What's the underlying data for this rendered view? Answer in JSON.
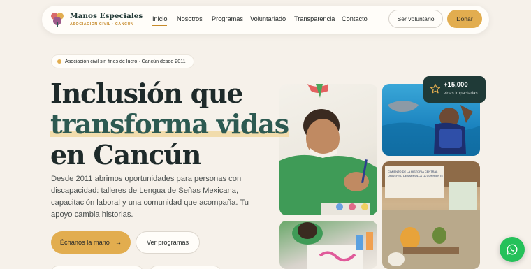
{
  "nav": {
    "brand_name": "Manos Especiales",
    "brand_sub": "ASOCIACIÓN CIVIL · CANCÚN",
    "links": [
      "Inicio",
      "Nosotros",
      "Programas",
      "Voluntariado",
      "Transparencia",
      "Contacto"
    ],
    "active_link": "Inicio",
    "volunteer_label": "Ser voluntario",
    "donate_label": "Donar"
  },
  "hero": {
    "badge": "Asociación civil sin fines de lucro · Cancún desde 2011",
    "headline_1": "Inclusión que",
    "headline_2": "transforma vidas",
    "headline_3": "en Cancún",
    "description": "Desde 2011 abrimos oportunidades para personas con discapacidad: talleres de Lengua de Señas Mexicana, capacitación laboral y una comunidad que acompaña. Tu apoyo cambia historias.",
    "primary_label": "Échanos la mano",
    "primary_arrow": "→",
    "secondary_label": "Ver programas"
  },
  "stat": {
    "number": "+15,000",
    "label": "vidas impactadas",
    "icon": "star-icon"
  },
  "photo_sign": {
    "line1": "CIMIENTO DE LA HISTORIA CENTRAL",
    "line2": "UNIVERSO DESARROLLA LA CORRIENTE"
  },
  "colors": {
    "accent": "#e2ad4f",
    "dark": "#1f3a37",
    "background": "#f6f1ea",
    "whatsapp": "#25c15a"
  }
}
